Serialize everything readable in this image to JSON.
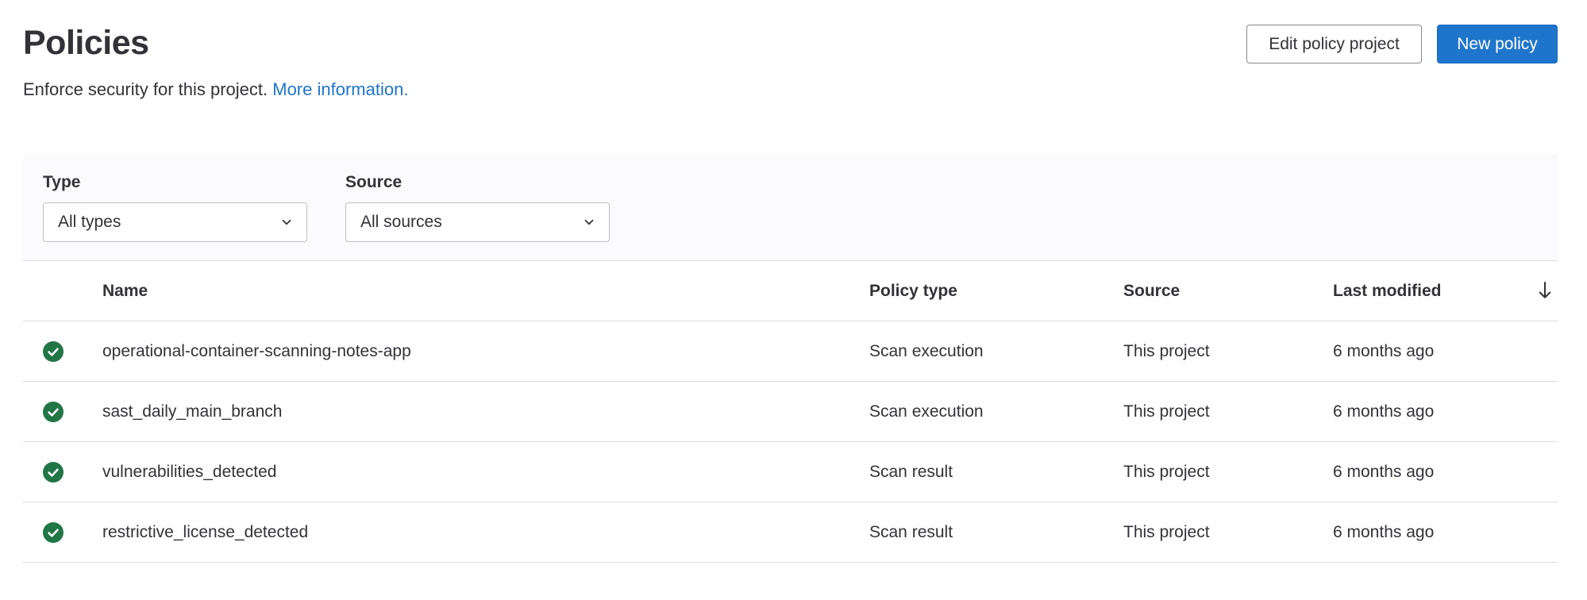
{
  "header": {
    "title": "Policies",
    "description": "Enforce security for this project.",
    "more_info_link": "More information.",
    "edit_button": "Edit policy project",
    "new_button": "New policy"
  },
  "filters": {
    "type_label": "Type",
    "type_value": "All types",
    "source_label": "Source",
    "source_value": "All sources"
  },
  "table": {
    "columns": {
      "name": "Name",
      "policy_type": "Policy type",
      "source": "Source",
      "last_modified": "Last modified"
    },
    "rows": [
      {
        "status": "enabled",
        "name": "operational-container-scanning-notes-app",
        "policy_type": "Scan execution",
        "source": "This project",
        "last_modified": "6 months ago"
      },
      {
        "status": "enabled",
        "name": "sast_daily_main_branch",
        "policy_type": "Scan execution",
        "source": "This project",
        "last_modified": "6 months ago"
      },
      {
        "status": "enabled",
        "name": "vulnerabilities_detected",
        "policy_type": "Scan result",
        "source": "This project",
        "last_modified": "6 months ago"
      },
      {
        "status": "enabled",
        "name": "restrictive_license_detected",
        "policy_type": "Scan result",
        "source": "This project",
        "last_modified": "6 months ago"
      }
    ]
  },
  "colors": {
    "primary": "#1f75cb",
    "success": "#217645",
    "text": "#333238",
    "border": "#dcdcde"
  },
  "icons": {
    "status": "check-circle-filled-icon",
    "dropdown": "chevron-down-icon",
    "sort": "arrow-down-icon"
  }
}
